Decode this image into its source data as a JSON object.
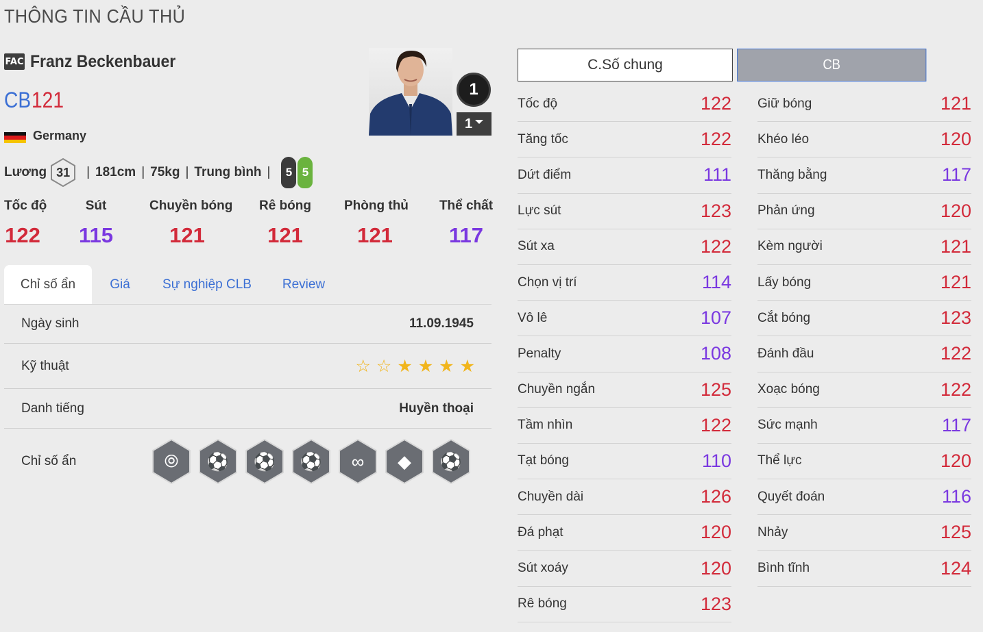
{
  "page": {
    "title": "THÔNG TIN CẦU THỦ"
  },
  "player": {
    "season_badge": "FAC",
    "name": "Franz Beckenbauer",
    "position": "CB",
    "ovr": "121",
    "nation": "Germany",
    "salary_label": "Lương",
    "salary": "31",
    "height": "181cm",
    "weight": "75kg",
    "body_type": "Trung bình",
    "separator": "|",
    "weak_foot_left": "5",
    "weak_foot_right": "5",
    "team_color_level": "1",
    "upgrade_level": "1"
  },
  "main_stats": [
    {
      "label": "Tốc độ",
      "value": "122",
      "color": "red"
    },
    {
      "label": "Sút",
      "value": "115",
      "color": "purple"
    },
    {
      "label": "Chuyền bóng",
      "value": "121",
      "color": "red"
    },
    {
      "label": "Rê bóng",
      "value": "121",
      "color": "red"
    },
    {
      "label": "Phòng thủ",
      "value": "121",
      "color": "red"
    },
    {
      "label": "Thể chất",
      "value": "117",
      "color": "purple"
    }
  ],
  "tabs": [
    {
      "label": "Chỉ số ẩn",
      "active": true
    },
    {
      "label": "Giá",
      "active": false
    },
    {
      "label": "Sự nghiệp CLB",
      "active": false
    },
    {
      "label": "Review",
      "active": false
    }
  ],
  "details": {
    "birth_label": "Ngày sinh",
    "birth_value": "11.09.1945",
    "skill_label": "Kỹ thuật",
    "skill_stars": 4,
    "skill_stars_max": 6,
    "reputation_label": "Danh tiếng",
    "reputation_value": "Huyền thoại",
    "traits_label": "Chỉ số ẩn",
    "traits": [
      "speed-boot-icon",
      "long-pass-icon",
      "flair-icon",
      "tie-pass-icon",
      "dribbling-path-icon",
      "diamond-icon",
      "puppet-playmaker-icon"
    ]
  },
  "stat_tabs": {
    "total": "C.Số chung",
    "position": "CB",
    "active": "position"
  },
  "stats_left": [
    {
      "label": "Tốc độ",
      "value": "122",
      "color": "red"
    },
    {
      "label": "Tăng tốc",
      "value": "122",
      "color": "red"
    },
    {
      "label": "Dứt điểm",
      "value": "111",
      "color": "purple"
    },
    {
      "label": "Lực sút",
      "value": "123",
      "color": "red"
    },
    {
      "label": "Sút xa",
      "value": "122",
      "color": "red"
    },
    {
      "label": "Chọn vị trí",
      "value": "114",
      "color": "purple"
    },
    {
      "label": "Vô lê",
      "value": "107",
      "color": "purple"
    },
    {
      "label": "Penalty",
      "value": "108",
      "color": "purple"
    },
    {
      "label": "Chuyền ngắn",
      "value": "125",
      "color": "red"
    },
    {
      "label": "Tầm nhìn",
      "value": "122",
      "color": "red"
    },
    {
      "label": "Tạt bóng",
      "value": "110",
      "color": "purple"
    },
    {
      "label": "Chuyền dài",
      "value": "126",
      "color": "red"
    },
    {
      "label": "Đá phạt",
      "value": "120",
      "color": "red"
    },
    {
      "label": "Sút xoáy",
      "value": "120",
      "color": "red"
    },
    {
      "label": "Rê bóng",
      "value": "123",
      "color": "red"
    }
  ],
  "stats_right": [
    {
      "label": "Giữ bóng",
      "value": "121",
      "color": "red"
    },
    {
      "label": "Khéo léo",
      "value": "120",
      "color": "red"
    },
    {
      "label": "Thăng bằng",
      "value": "117",
      "color": "purple"
    },
    {
      "label": "Phản ứng",
      "value": "120",
      "color": "red"
    },
    {
      "label": "Kèm người",
      "value": "121",
      "color": "red"
    },
    {
      "label": "Lấy bóng",
      "value": "121",
      "color": "red"
    },
    {
      "label": "Cắt bóng",
      "value": "123",
      "color": "red"
    },
    {
      "label": "Đánh đầu",
      "value": "122",
      "color": "red"
    },
    {
      "label": "Xoạc bóng",
      "value": "122",
      "color": "red"
    },
    {
      "label": "Sức mạnh",
      "value": "117",
      "color": "purple"
    },
    {
      "label": "Thể lực",
      "value": "120",
      "color": "red"
    },
    {
      "label": "Quyết đoán",
      "value": "116",
      "color": "purple"
    },
    {
      "label": "Nhảy",
      "value": "125",
      "color": "red"
    },
    {
      "label": "Bình tĩnh",
      "value": "124",
      "color": "red"
    }
  ]
}
